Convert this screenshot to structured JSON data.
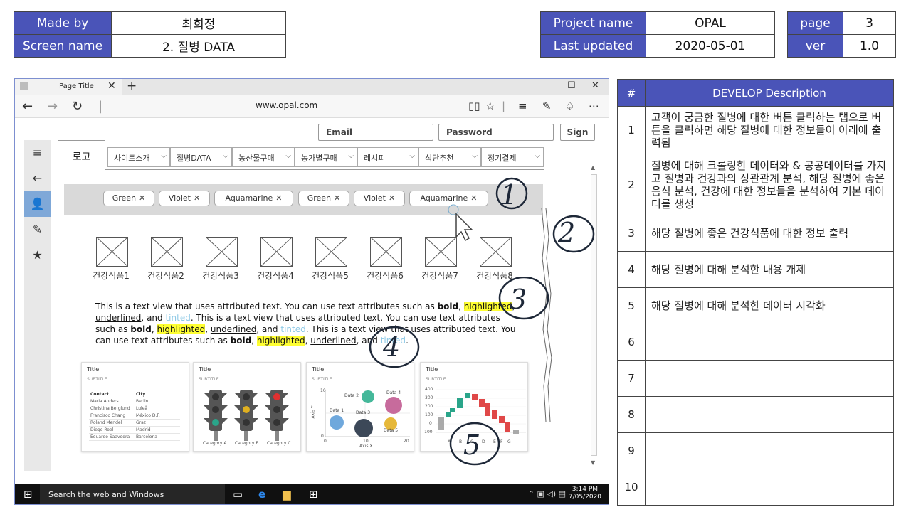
{
  "header": {
    "made_by_label": "Made by",
    "made_by": "최희정",
    "screen_name_label": "Screen name",
    "screen_name": "2. 질병 DATA",
    "project_name_label": "Project name",
    "project_name": "OPAL",
    "last_updated_label": "Last updated",
    "last_updated": "2020-05-01",
    "page_label": "page",
    "page": "3",
    "ver_label": "ver",
    "ver": "1.0"
  },
  "description": {
    "col_num": "#",
    "col_desc": "DEVELOP  Description",
    "rows": [
      {
        "num": "1",
        "text": "고객이 궁금한 질병에 대한 버튼 클릭하는 탭으로 버튼을 클릭하면 해당 질병에 대한 정보들이 아래에 출력됨"
      },
      {
        "num": "2",
        "text": "질병에 대해 크롤링한 데이터와 & 공공데이터를 가지고 질병과 건강과의 상관관계 분석, 해당 질병에 좋은 음식 분석, 건강에 대한 정보들을 분석하여 기본 데이터를 생성"
      },
      {
        "num": "3",
        "text": "해당 질병에 좋은 건강식품에 대한 정보 출력"
      },
      {
        "num": "4",
        "text": "해당 질병에 대해 분석한 내용 개제"
      },
      {
        "num": "5",
        "text": "해당 질병에 대해 분석한 데이터 시각화"
      },
      {
        "num": "6",
        "text": ""
      },
      {
        "num": "7",
        "text": ""
      },
      {
        "num": "8",
        "text": ""
      },
      {
        "num": "9",
        "text": ""
      },
      {
        "num": "10",
        "text": ""
      }
    ]
  },
  "browser": {
    "tab_title": "Page Title",
    "url": "www.opal.com",
    "email_placeholder": "Email",
    "password_placeholder": "Password",
    "sign_label": "Sign",
    "logo_tab": "로고",
    "menus": [
      "사이트소개",
      "질병DATA",
      "농산물구매",
      "농가별구매",
      "레시피",
      "식단추천",
      "정기결제"
    ],
    "chips": [
      "Green",
      "Violet",
      "Aquamarine",
      "Green",
      "Violet",
      "Aquamarine"
    ],
    "foods": [
      "건강식품1",
      "건강식품2",
      "건강식품3",
      "건강식품4",
      "건강식품5",
      "건강식품6",
      "건강식품7",
      "건강식품8"
    ],
    "text_view": {
      "intro": "This is a text view that uses attributed text. You can use text attributes such as ",
      "bold": "bold",
      "highlighted": "highlighted",
      "underlined": "underlined",
      "and": "and",
      "tinted": "tinted"
    },
    "cards": {
      "title": "Title",
      "subtitle": "SUBTITLE",
      "table_headers": [
        "Contact",
        "City"
      ],
      "table_rows": [
        [
          "Maria Anders",
          "Berlin"
        ],
        [
          "Christina Berglund",
          "Luleå"
        ],
        [
          "Francisco Chang",
          "México D.F."
        ],
        [
          "Roland Mendel",
          "Graz"
        ],
        [
          "Diego Roel",
          "Madrid"
        ],
        [
          "Eduardo Saavedra",
          "Barcelona"
        ]
      ],
      "traffic_labels": [
        "Category A",
        "Category B",
        "Category C"
      ],
      "bubble": {
        "ylabel": "Axis Y",
        "xlabel": "Axis X",
        "labels": [
          "Data 1",
          "Data 2",
          "Data 3",
          "Data 4",
          "Data 5"
        ],
        "x_ticks": [
          "0",
          "10",
          "20"
        ],
        "y_ticks": [
          "10",
          "0"
        ]
      },
      "waterfall": {
        "y_ticks": [
          "400",
          "300",
          "200",
          "100",
          "0",
          "-100"
        ],
        "x_ticks": [
          "A",
          "B",
          "C",
          "D",
          "E",
          "F",
          "G"
        ]
      }
    },
    "taskbar": {
      "search": "Search the web and Windows",
      "time": "3:14 PM",
      "date": "7/05/2020"
    }
  },
  "annotations": [
    "1",
    "2",
    "3",
    "4",
    "5"
  ]
}
